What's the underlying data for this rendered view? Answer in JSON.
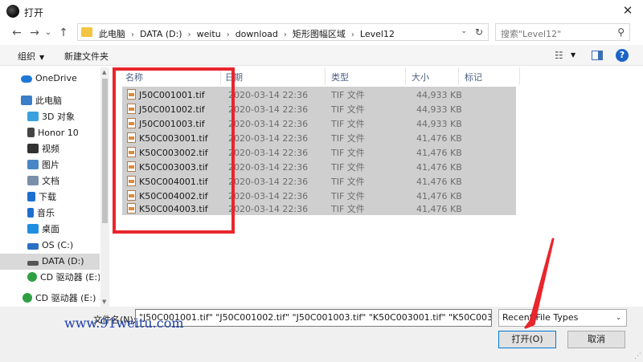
{
  "window": {
    "title": "打开",
    "close_glyph": "✕"
  },
  "nav": {
    "back": "←",
    "forward": "→",
    "up_dropdown": "⌄",
    "up": "↑",
    "breadcrumbs": [
      "此电脑",
      "DATA (D:)",
      "weitu",
      "download",
      "矩形图幅区域",
      "Level12"
    ],
    "crumb_separator": "›",
    "search_placeholder": "搜索\"Level12\""
  },
  "toolbar": {
    "organize": "组织",
    "new_folder": "新建文件夹",
    "help": "?"
  },
  "sidebar": {
    "items": [
      {
        "label": "OneDrive",
        "icon": "onedrive-icon",
        "color": "#1e78d6"
      },
      {
        "label": "此电脑",
        "icon": "computer-icon",
        "color": "#3a7dc9"
      },
      {
        "label": "3D 对象",
        "icon": "cube-icon",
        "color": "#3aa0e0"
      },
      {
        "label": "Honor 10",
        "icon": "phone-icon",
        "color": "#444444"
      },
      {
        "label": "视频",
        "icon": "video-icon",
        "color": "#333333"
      },
      {
        "label": "图片",
        "icon": "pictures-icon",
        "color": "#4a86c5"
      },
      {
        "label": "文档",
        "icon": "documents-icon",
        "color": "#7a8fa8"
      },
      {
        "label": "下载",
        "icon": "download-icon",
        "color": "#1e6fd0"
      },
      {
        "label": "音乐",
        "icon": "music-icon",
        "color": "#1e6fd0"
      },
      {
        "label": "桌面",
        "icon": "desktop-icon",
        "color": "#1e8fe0"
      },
      {
        "label": "OS (C:)",
        "icon": "drive-c-icon",
        "color": "#2a6fc2"
      },
      {
        "label": "DATA (D:)",
        "icon": "drive-d-icon",
        "color": "#555555"
      },
      {
        "label": "CD 驱动器 (E:) Hi",
        "icon": "cd-drive-icon",
        "color": "#2ea043"
      },
      {
        "label": "CD 驱动器 (E:) Hi",
        "icon": "cd-drive-icon",
        "color": "#2ea043"
      }
    ]
  },
  "columns": {
    "name": "名称",
    "date": "日期",
    "type": "类型",
    "size": "大小",
    "tags": "标记"
  },
  "files": [
    {
      "name": "J50C001001.tif",
      "date": "2020-03-14 22:36",
      "type": "TIF 文件",
      "size": "44,933 KB"
    },
    {
      "name": "J50C001002.tif",
      "date": "2020-03-14 22:36",
      "type": "TIF 文件",
      "size": "44,933 KB"
    },
    {
      "name": "J50C001003.tif",
      "date": "2020-03-14 22:36",
      "type": "TIF 文件",
      "size": "44,933 KB"
    },
    {
      "name": "K50C003001.tif",
      "date": "2020-03-14 22:36",
      "type": "TIF 文件",
      "size": "41,476 KB"
    },
    {
      "name": "K50C003002.tif",
      "date": "2020-03-14 22:36",
      "type": "TIF 文件",
      "size": "41,476 KB"
    },
    {
      "name": "K50C003003.tif",
      "date": "2020-03-14 22:36",
      "type": "TIF 文件",
      "size": "41,476 KB"
    },
    {
      "name": "K50C004001.tif",
      "date": "2020-03-14 22:36",
      "type": "TIF 文件",
      "size": "41,476 KB"
    },
    {
      "name": "K50C004002.tif",
      "date": "2020-03-14 22:36",
      "type": "TIF 文件",
      "size": "41,476 KB"
    },
    {
      "name": "K50C004003.tif",
      "date": "2020-03-14 22:36",
      "type": "TIF 文件",
      "size": "41,476 KB"
    }
  ],
  "bottom": {
    "filename_label": "文件名(N):",
    "filename_value": "\"J50C001001.tif\" \"J50C001002.tif\" \"J50C001003.tif\" \"K50C003001.tif\" \"K50C003002.tif\" \"K5",
    "filetype_value": "Recent File Types",
    "open_button": "打开(O)",
    "cancel_button": "取消"
  },
  "watermark": "www.91weitu.com",
  "colors": {
    "annotation_red": "#e8262c",
    "selection": "#cfcfcf",
    "accent": "#0078d7"
  }
}
